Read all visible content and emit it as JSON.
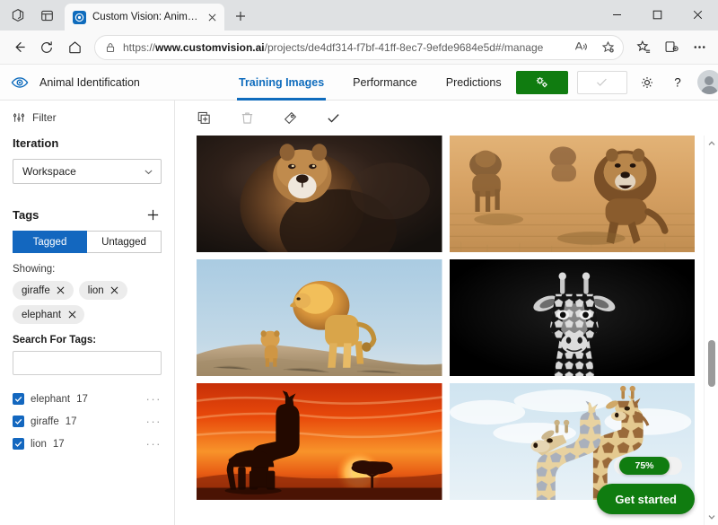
{
  "browser": {
    "workspaces_icon": "workspaces-icon",
    "tab_actions_icon": "tab-actions-icon",
    "tab": {
      "favicon": "custom-vision-favicon",
      "title": "Custom Vision: Animal Identification",
      "close_icon": "close-icon"
    },
    "new_tab_icon": "plus-icon",
    "window_controls": {
      "minimize": "minimize-icon",
      "maximize": "maximize-icon",
      "close": "close-icon"
    },
    "nav": {
      "back_icon": "back-arrow-icon",
      "refresh_icon": "refresh-icon",
      "home_icon": "home-icon"
    },
    "omnibox": {
      "lock_icon": "lock-icon",
      "url_prefix": "https://",
      "url_domain": "www.customvision.ai",
      "url_path": "/projects/de4df314-f7bf-41ff-8ec7-9efde9684e5d#/manage",
      "url_full": "https://www.customvision.ai/projects/de4df314-f7bf-41ff-8ec7-9efde9684e5d#/manage",
      "read_aloud_icon": "read-aloud-icon",
      "add_favorite_icon": "add-favorite-icon"
    },
    "toolbar_icons": {
      "favorites": "favorites-icon",
      "collections": "collections-icon",
      "settings_more": "more-settings-icon"
    }
  },
  "app": {
    "logo_icon": "eye-logo-icon",
    "project_title": "Animal Identification",
    "tabs": [
      {
        "label": "Training Images",
        "active": true
      },
      {
        "label": "Performance",
        "active": false
      },
      {
        "label": "Predictions",
        "active": false
      }
    ],
    "train_button": {
      "icon": "gears-icon",
      "color": "#107c10"
    },
    "quick_test_button": {
      "icon": "check-icon",
      "disabled": true
    },
    "settings_icon": "gear-icon",
    "help_icon": "question-mark-icon",
    "avatar": "user-avatar"
  },
  "sidebar": {
    "filter": {
      "icon": "filter-icon",
      "label": "Filter"
    },
    "iteration": {
      "title": "Iteration",
      "selected": "Workspace",
      "chevron": "chevron-down-icon"
    },
    "tags": {
      "title": "Tags",
      "add_icon": "plus-icon",
      "toggle": [
        {
          "label": "Tagged",
          "active": true
        },
        {
          "label": "Untagged",
          "active": false
        }
      ],
      "showing_label": "Showing:",
      "chips": [
        {
          "label": "giraffe",
          "remove_icon": "close-icon"
        },
        {
          "label": "lion",
          "remove_icon": "close-icon"
        },
        {
          "label": "elephant",
          "remove_icon": "close-icon"
        }
      ],
      "search_label": "Search For Tags:",
      "search_value": "",
      "search_placeholder": "",
      "list": [
        {
          "name": "elephant",
          "count": "17",
          "checked": true,
          "menu": "···"
        },
        {
          "name": "giraffe",
          "count": "17",
          "checked": true,
          "menu": "···"
        },
        {
          "name": "lion",
          "count": "17",
          "checked": true,
          "menu": "···"
        }
      ]
    }
  },
  "main": {
    "toolbar": [
      {
        "icon": "add-images-icon",
        "name": "add-images-button"
      },
      {
        "icon": "trash-icon",
        "name": "delete-images-button"
      },
      {
        "icon": "tag-icon",
        "name": "tag-images-button"
      },
      {
        "icon": "check-icon",
        "name": "select-all-button"
      }
    ],
    "images": [
      {
        "alt": "lion-portrait-dark",
        "tag": "lion"
      },
      {
        "alt": "lions-running-savanna",
        "tag": "lion"
      },
      {
        "alt": "lion-and-cub-on-rock",
        "tag": "lion"
      },
      {
        "alt": "giraffe-black-and-white-portrait",
        "tag": "giraffe"
      },
      {
        "alt": "giraffe-silhouette-sunset",
        "tag": "giraffe"
      },
      {
        "alt": "two-giraffes-blue-sky",
        "tag": "giraffe"
      }
    ],
    "scrollbar": {
      "up_icon": "scroll-up-icon",
      "down_icon": "scroll-down-icon"
    }
  },
  "overlay": {
    "progress_value": "75%",
    "get_started_label": "Get started",
    "accent_color": "#107c10"
  },
  "colors": {
    "accent_blue": "#0f6cbd",
    "toggle_blue": "#1367bf",
    "green": "#107c10"
  }
}
